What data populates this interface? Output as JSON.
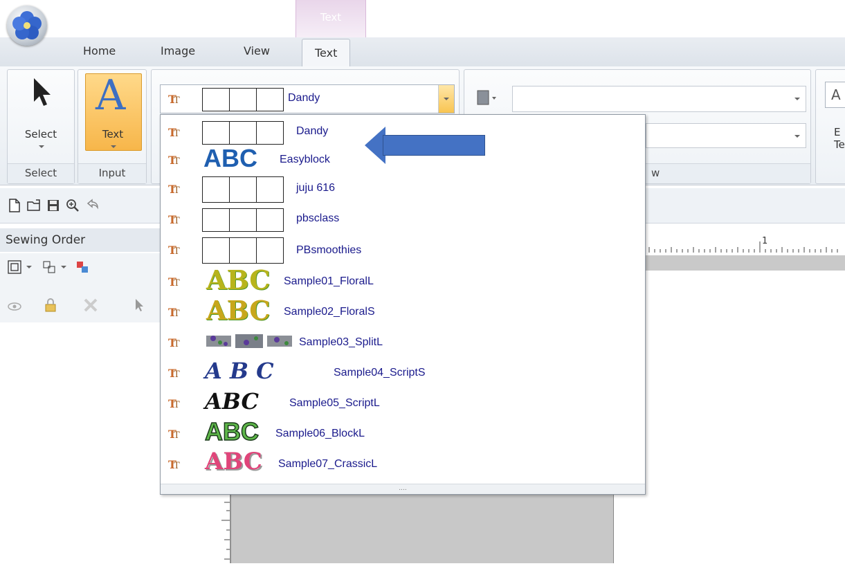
{
  "ribbon": {
    "contextual_tab": "Text",
    "tabs": [
      "Home",
      "Image",
      "View",
      "Text"
    ],
    "active_tab": "Text",
    "groups": {
      "select": {
        "button_label": "Select",
        "caption": "Select"
      },
      "input": {
        "button_label": "Text",
        "caption": "Input"
      },
      "font": {
        "selected_font": "Dandy"
      },
      "right_caption_fragment": "w",
      "edge_label_line1": "E",
      "edge_label_line2": "Te",
      "edge_box_letter": "A"
    }
  },
  "sewing_order": {
    "title": "Sewing Order"
  },
  "ruler": {
    "mark": "1"
  },
  "dropdown": {
    "items": [
      {
        "name": "Dandy",
        "preview": "boxes"
      },
      {
        "name": "Easyblock",
        "preview": "ABC"
      },
      {
        "name": "juju 616",
        "preview": "boxes"
      },
      {
        "name": "pbsclass",
        "preview": "boxes"
      },
      {
        "name": "PBsmoothies",
        "preview": "boxes"
      },
      {
        "name": "Sample01_FloralL",
        "preview": "ABC"
      },
      {
        "name": "Sample02_FloralS",
        "preview": "ABC"
      },
      {
        "name": "Sample03_SplitL",
        "preview": "graphic"
      },
      {
        "name": "Sample04_ScriptS",
        "preview": "ABC"
      },
      {
        "name": "Sample05_ScriptL",
        "preview": "ABC"
      },
      {
        "name": "Sample06_BlockL",
        "preview": "ABC"
      },
      {
        "name": "Sample07_CrassicL",
        "preview": "ABC"
      }
    ],
    "preview_text": "ABC",
    "script_preview_text": "A B C",
    "grip": "...."
  },
  "colors": {
    "accent_arrow": "#4472c4",
    "font_name": "#1a1a8c",
    "text_tab": "#e9d6ea"
  }
}
